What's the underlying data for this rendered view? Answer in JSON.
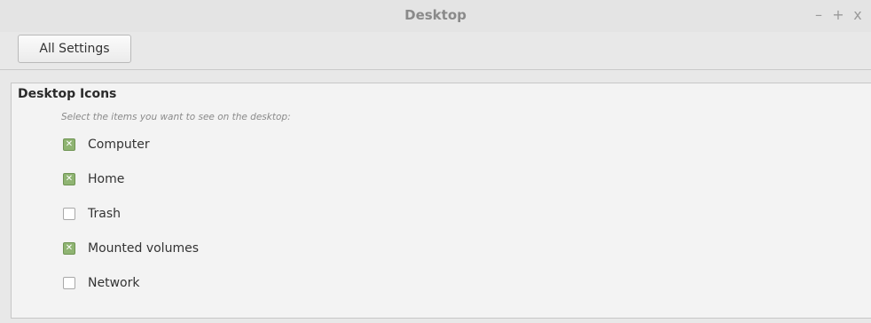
{
  "window": {
    "title": "Desktop",
    "controls": {
      "minimize": "–",
      "maximize": "+",
      "close": "x"
    }
  },
  "toolbar": {
    "all_settings_label": "All Settings"
  },
  "section": {
    "title": "Desktop Icons",
    "subtitle": "Select the items you want to see on the desktop:",
    "items": [
      {
        "label": "Computer",
        "checked": true
      },
      {
        "label": "Home",
        "checked": true
      },
      {
        "label": "Trash",
        "checked": false
      },
      {
        "label": "Mounted volumes",
        "checked": true
      },
      {
        "label": "Network",
        "checked": false
      }
    ]
  },
  "colors": {
    "checked_fill": "#8fb472",
    "window_bg": "#e8e8e8"
  }
}
